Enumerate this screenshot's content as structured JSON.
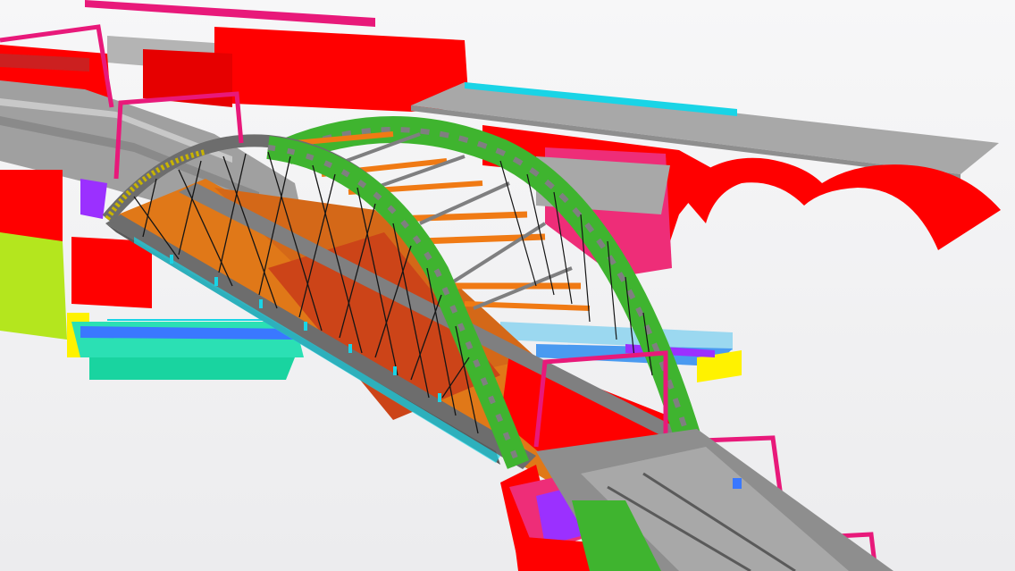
{
  "viewport": {
    "background": "#f2f2f4"
  },
  "palette": {
    "steel_grey": "#7f7f80",
    "arch_green": "#3fb42f",
    "abutment_red": "#ff0000",
    "frame_magenta": "#e8197a",
    "brace_orange": "#f07a14",
    "rail_cyan": "#19d4e6",
    "deck_orange": "#e07818",
    "pile_lime": "#b4e61e",
    "cable_black": "#151515",
    "platform_grey": "#a8a8a8",
    "pink_block": "#ee2d78",
    "purple": "#9b30ff",
    "yellow": "#fff200"
  },
  "model_elements": [
    "bridge-arch-near",
    "bridge-arch-far",
    "hanger-cables",
    "arch-bracing",
    "bridge-deck",
    "abutments",
    "portal-frames",
    "platform-roof",
    "railing",
    "piles"
  ]
}
